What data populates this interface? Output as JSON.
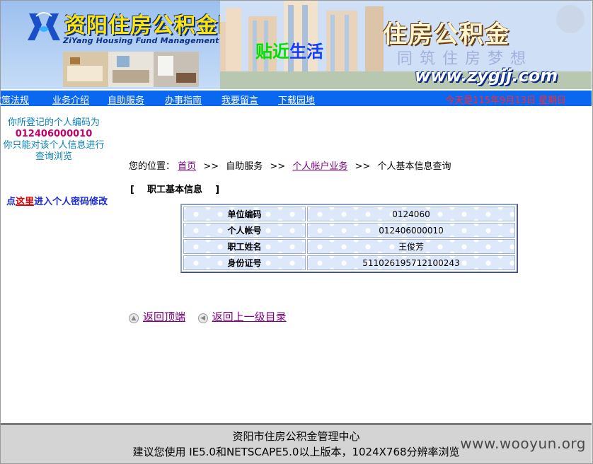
{
  "header": {
    "site_title": "资阳住房公积金网",
    "site_subtitle": "ZiYang Housing Fund Management Center",
    "welcome_part1": "贴近",
    "welcome_part2": "生活",
    "fund_text": "住房公积金",
    "dream_text": "同筑住房梦想",
    "url_text": "www.zygjj.com"
  },
  "nav": {
    "items": [
      "政策法规",
      "业务介绍",
      "自助服务",
      "办事指南",
      "我要留言",
      "下载园地"
    ],
    "date_text": "今天是115年9月13日 星期日"
  },
  "sidebar": {
    "line1": "你所登记的个人编码为",
    "code": "012406000010",
    "line2": "你只能对该个人信息进行",
    "line3": "查询浏览",
    "pwd_prefix": "点",
    "pwd_link": "这里",
    "pwd_suffix": "进入个人密码修改"
  },
  "breadcrumb": {
    "label": "您的位置：",
    "home": "首页",
    "self_service": "自助服务",
    "personal_account": "个人帐户业务",
    "current": "个人基本信息查询",
    "separator": ">>"
  },
  "section_title": "[    职工基本信息    ]",
  "info_table": {
    "rows": [
      {
        "label": "单位编码",
        "value": "0124060"
      },
      {
        "label": "个人帐号",
        "value": "012406000010"
      },
      {
        "label": "职工姓名",
        "value": "王俊芳"
      },
      {
        "label": "身份证号",
        "value": "511026195712100243"
      }
    ]
  },
  "back_links": {
    "top": "返回顶端",
    "up": "返回上一级目录"
  },
  "footer": {
    "line1": "资阳市住房公积金管理中心",
    "line2": "建议您使用 IE5.0和NETSCAPE5.0以上版本，1024X768分辨率浏览",
    "watermark": "www.wooyun.org"
  },
  "colors": {
    "nav_bg": "#0a67f0",
    "link_visited": "#800080",
    "date_red": "#ff2a2a",
    "code_magenta": "#c4006a"
  }
}
